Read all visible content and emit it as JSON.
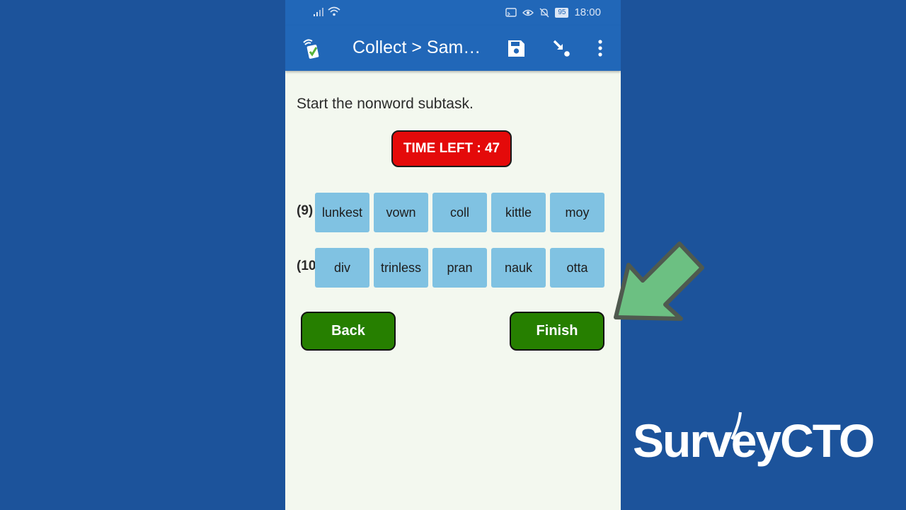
{
  "status_bar": {
    "time": "18:00",
    "battery": "95"
  },
  "toolbar": {
    "title": "Collect > Sam…"
  },
  "prompt": "Start the nonword subtask.",
  "timer": {
    "text": "TIME LEFT : 47"
  },
  "rows": [
    {
      "label": "(9)",
      "words": [
        "lunkest",
        "vown",
        "coll",
        "kittle",
        "moy"
      ]
    },
    {
      "label": "(10)",
      "words": [
        "div",
        "trinless",
        "pran",
        "nauk",
        "otta"
      ]
    }
  ],
  "buttons": {
    "back": "Back",
    "finish": "Finish"
  },
  "brand": {
    "logo_text": "SurveyCTO"
  },
  "colors": {
    "background": "#1c539b",
    "toolbar": "#2167b8",
    "timer": "#e40a0a",
    "word_tile": "#80c2e2",
    "nav_button": "#267f00",
    "arrow": "#6cc082"
  }
}
